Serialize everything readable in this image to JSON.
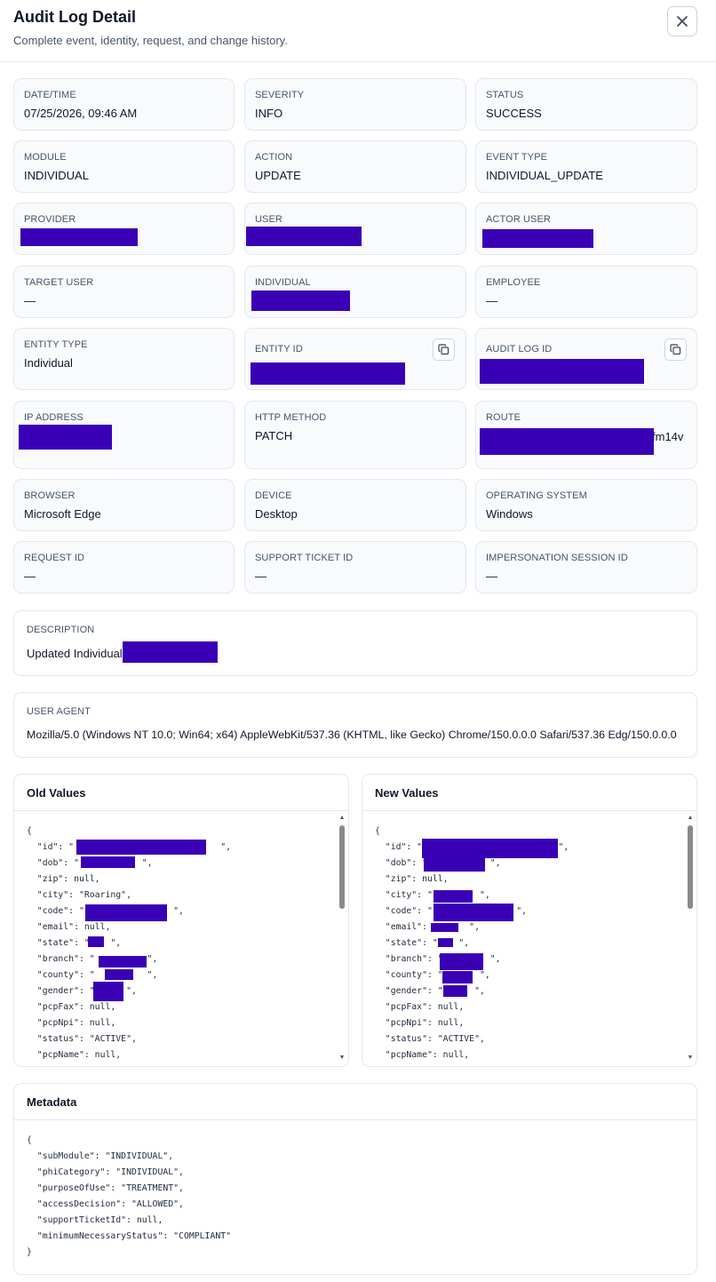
{
  "header": {
    "title": "Audit Log Detail",
    "subtitle": "Complete event, identity, request, and change history.",
    "close_icon": "x-icon"
  },
  "fields": {
    "datetime": {
      "label": "DATE/TIME",
      "value": "07/25/2026, 09:46 AM"
    },
    "severity": {
      "label": "SEVERITY",
      "value": "INFO"
    },
    "status": {
      "label": "STATUS",
      "value": "SUCCESS"
    },
    "module": {
      "label": "MODULE",
      "value": "INDIVIDUAL"
    },
    "action": {
      "label": "ACTION",
      "value": "UPDATE"
    },
    "event_type": {
      "label": "EVENT TYPE",
      "value": "INDIVIDUAL_UPDATE"
    },
    "provider": {
      "label": "PROVIDER"
    },
    "user": {
      "label": "USER"
    },
    "actor_user": {
      "label": "ACTOR USER"
    },
    "target_user": {
      "label": "TARGET USER",
      "value": "—"
    },
    "individual": {
      "label": "INDIVIDUAL"
    },
    "employee": {
      "label": "EMPLOYEE",
      "value": "—"
    },
    "entity_type": {
      "label": "ENTITY TYPE",
      "value": "Individual"
    },
    "entity_id": {
      "label": "ENTITY ID"
    },
    "audit_log_id": {
      "label": "AUDIT LOG ID"
    },
    "ip_address": {
      "label": "IP ADDRESS"
    },
    "http_method": {
      "label": "HTTP METHOD",
      "value": "PATCH"
    },
    "route": {
      "label": "ROUTE",
      "visible_suffix": "fm14v"
    },
    "browser": {
      "label": "BROWSER",
      "value": "Microsoft Edge"
    },
    "device": {
      "label": "DEVICE",
      "value": "Desktop"
    },
    "os": {
      "label": "OPERATING SYSTEM",
      "value": "Windows"
    },
    "request_id": {
      "label": "REQUEST ID",
      "value": "—"
    },
    "support_ticket_id": {
      "label": "SUPPORT TICKET ID",
      "value": "—"
    },
    "impersonation_session_id": {
      "label": "IMPERSONATION SESSION ID",
      "value": "—"
    }
  },
  "description": {
    "label": "DESCRIPTION",
    "value_prefix": "Updated Individual"
  },
  "user_agent": {
    "label": "USER AGENT",
    "value": "Mozilla/5.0 (Windows NT 10.0; Win64; x64) AppleWebKit/537.36 (KHTML, like Gecko) Chrome/150.0.0.0 Safari/537.36 Edg/150.0.0.0"
  },
  "old_values": {
    "title": "Old Values",
    "lines": [
      "{",
      "  \"id\": \"                            \",",
      "  \"dob\": \"            \",",
      "  \"zip\": null,",
      "  \"city\": \"Roaring\",",
      "  \"code\": \"                 \",",
      "  \"email\": null,",
      "  \"state\": \"    \",",
      "  \"branch\": \"          \",",
      "  \"county\": \"          \",",
      "  \"gender\": \"      \",",
      "  \"pcpFax\": null,",
      "  \"pcpNpi\": null,",
      "  \"status\": \"ACTIVE\",",
      "  \"pcpName\": null,"
    ]
  },
  "new_values": {
    "title": "New Values",
    "lines": [
      "{",
      "  \"id\": \"                          \",",
      "  \"dob\": \"            \",",
      "  \"zip\": null,",
      "  \"city\": \"         \",",
      "  \"code\": \"                \",",
      "  \"email\": \"      \",",
      "  \"state\": \"    \",",
      "  \"branch\": \"         \",",
      "  \"county\": \"       \",",
      "  \"gender\": \"      \",",
      "  \"pcpFax\": null,",
      "  \"pcpNpi\": null,",
      "  \"status\": \"ACTIVE\",",
      "  \"pcpName\": null,"
    ]
  },
  "metadata": {
    "title": "Metadata",
    "lines": [
      "{",
      "  \"subModule\": \"INDIVIDUAL\",",
      "  \"phiCategory\": \"INDIVIDUAL\",",
      "  \"purposeOfUse\": \"TREATMENT\",",
      "  \"accessDecision\": \"ALLOWED\",",
      "  \"supportTicketId\": null,",
      "  \"minimumNecessaryStatus\": \"COMPLIANT\"",
      "}"
    ]
  },
  "colors": {
    "redaction": "#3a00b5",
    "card_background": "#f8fafc",
    "border": "#e2e8f0",
    "label": "#475569"
  }
}
